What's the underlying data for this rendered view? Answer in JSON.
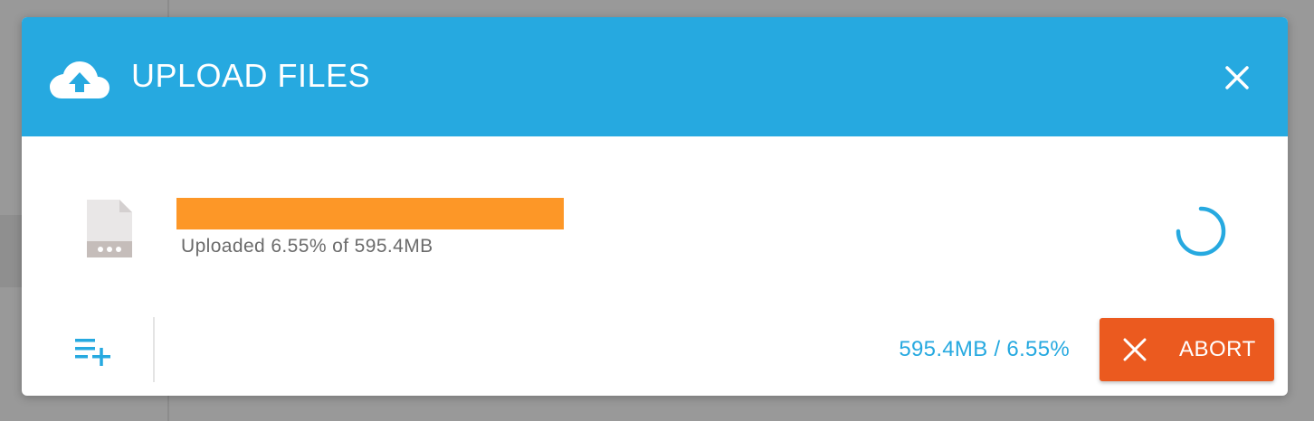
{
  "dialog": {
    "title": "UPLOAD FILES",
    "header_icon": "cloud-upload-icon",
    "close_icon": "close-icon"
  },
  "upload": {
    "file_icon": "file-icon",
    "progress_fraction": 0.0655,
    "progress_text": "Uploaded 6.55% of 595.4MB",
    "status_icon": "spinner-icon"
  },
  "footer": {
    "add_queue_icon": "playlist-add-icon",
    "summary": "595.4MB / 6.55%",
    "abort_label": "ABORT",
    "abort_icon": "close-icon"
  },
  "colors": {
    "header": "#26a9e0",
    "progress": "#fd9727",
    "abort": "#eb5a1f",
    "accent": "#26a9e0",
    "backdrop": "#999999"
  }
}
